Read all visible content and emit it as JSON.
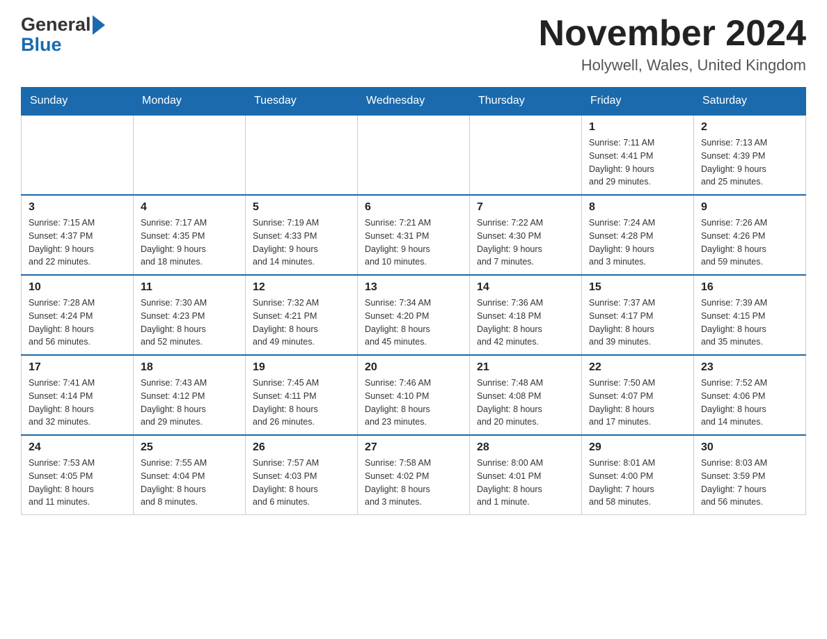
{
  "header": {
    "month_title": "November 2024",
    "location": "Holywell, Wales, United Kingdom",
    "logo_general": "General",
    "logo_blue": "Blue"
  },
  "weekdays": [
    "Sunday",
    "Monday",
    "Tuesday",
    "Wednesday",
    "Thursday",
    "Friday",
    "Saturday"
  ],
  "weeks": [
    {
      "days": [
        {
          "number": "",
          "info": ""
        },
        {
          "number": "",
          "info": ""
        },
        {
          "number": "",
          "info": ""
        },
        {
          "number": "",
          "info": ""
        },
        {
          "number": "",
          "info": ""
        },
        {
          "number": "1",
          "info": "Sunrise: 7:11 AM\nSunset: 4:41 PM\nDaylight: 9 hours\nand 29 minutes."
        },
        {
          "number": "2",
          "info": "Sunrise: 7:13 AM\nSunset: 4:39 PM\nDaylight: 9 hours\nand 25 minutes."
        }
      ]
    },
    {
      "days": [
        {
          "number": "3",
          "info": "Sunrise: 7:15 AM\nSunset: 4:37 PM\nDaylight: 9 hours\nand 22 minutes."
        },
        {
          "number": "4",
          "info": "Sunrise: 7:17 AM\nSunset: 4:35 PM\nDaylight: 9 hours\nand 18 minutes."
        },
        {
          "number": "5",
          "info": "Sunrise: 7:19 AM\nSunset: 4:33 PM\nDaylight: 9 hours\nand 14 minutes."
        },
        {
          "number": "6",
          "info": "Sunrise: 7:21 AM\nSunset: 4:31 PM\nDaylight: 9 hours\nand 10 minutes."
        },
        {
          "number": "7",
          "info": "Sunrise: 7:22 AM\nSunset: 4:30 PM\nDaylight: 9 hours\nand 7 minutes."
        },
        {
          "number": "8",
          "info": "Sunrise: 7:24 AM\nSunset: 4:28 PM\nDaylight: 9 hours\nand 3 minutes."
        },
        {
          "number": "9",
          "info": "Sunrise: 7:26 AM\nSunset: 4:26 PM\nDaylight: 8 hours\nand 59 minutes."
        }
      ]
    },
    {
      "days": [
        {
          "number": "10",
          "info": "Sunrise: 7:28 AM\nSunset: 4:24 PM\nDaylight: 8 hours\nand 56 minutes."
        },
        {
          "number": "11",
          "info": "Sunrise: 7:30 AM\nSunset: 4:23 PM\nDaylight: 8 hours\nand 52 minutes."
        },
        {
          "number": "12",
          "info": "Sunrise: 7:32 AM\nSunset: 4:21 PM\nDaylight: 8 hours\nand 49 minutes."
        },
        {
          "number": "13",
          "info": "Sunrise: 7:34 AM\nSunset: 4:20 PM\nDaylight: 8 hours\nand 45 minutes."
        },
        {
          "number": "14",
          "info": "Sunrise: 7:36 AM\nSunset: 4:18 PM\nDaylight: 8 hours\nand 42 minutes."
        },
        {
          "number": "15",
          "info": "Sunrise: 7:37 AM\nSunset: 4:17 PM\nDaylight: 8 hours\nand 39 minutes."
        },
        {
          "number": "16",
          "info": "Sunrise: 7:39 AM\nSunset: 4:15 PM\nDaylight: 8 hours\nand 35 minutes."
        }
      ]
    },
    {
      "days": [
        {
          "number": "17",
          "info": "Sunrise: 7:41 AM\nSunset: 4:14 PM\nDaylight: 8 hours\nand 32 minutes."
        },
        {
          "number": "18",
          "info": "Sunrise: 7:43 AM\nSunset: 4:12 PM\nDaylight: 8 hours\nand 29 minutes."
        },
        {
          "number": "19",
          "info": "Sunrise: 7:45 AM\nSunset: 4:11 PM\nDaylight: 8 hours\nand 26 minutes."
        },
        {
          "number": "20",
          "info": "Sunrise: 7:46 AM\nSunset: 4:10 PM\nDaylight: 8 hours\nand 23 minutes."
        },
        {
          "number": "21",
          "info": "Sunrise: 7:48 AM\nSunset: 4:08 PM\nDaylight: 8 hours\nand 20 minutes."
        },
        {
          "number": "22",
          "info": "Sunrise: 7:50 AM\nSunset: 4:07 PM\nDaylight: 8 hours\nand 17 minutes."
        },
        {
          "number": "23",
          "info": "Sunrise: 7:52 AM\nSunset: 4:06 PM\nDaylight: 8 hours\nand 14 minutes."
        }
      ]
    },
    {
      "days": [
        {
          "number": "24",
          "info": "Sunrise: 7:53 AM\nSunset: 4:05 PM\nDaylight: 8 hours\nand 11 minutes."
        },
        {
          "number": "25",
          "info": "Sunrise: 7:55 AM\nSunset: 4:04 PM\nDaylight: 8 hours\nand 8 minutes."
        },
        {
          "number": "26",
          "info": "Sunrise: 7:57 AM\nSunset: 4:03 PM\nDaylight: 8 hours\nand 6 minutes."
        },
        {
          "number": "27",
          "info": "Sunrise: 7:58 AM\nSunset: 4:02 PM\nDaylight: 8 hours\nand 3 minutes."
        },
        {
          "number": "28",
          "info": "Sunrise: 8:00 AM\nSunset: 4:01 PM\nDaylight: 8 hours\nand 1 minute."
        },
        {
          "number": "29",
          "info": "Sunrise: 8:01 AM\nSunset: 4:00 PM\nDaylight: 7 hours\nand 58 minutes."
        },
        {
          "number": "30",
          "info": "Sunrise: 8:03 AM\nSunset: 3:59 PM\nDaylight: 7 hours\nand 56 minutes."
        }
      ]
    }
  ]
}
